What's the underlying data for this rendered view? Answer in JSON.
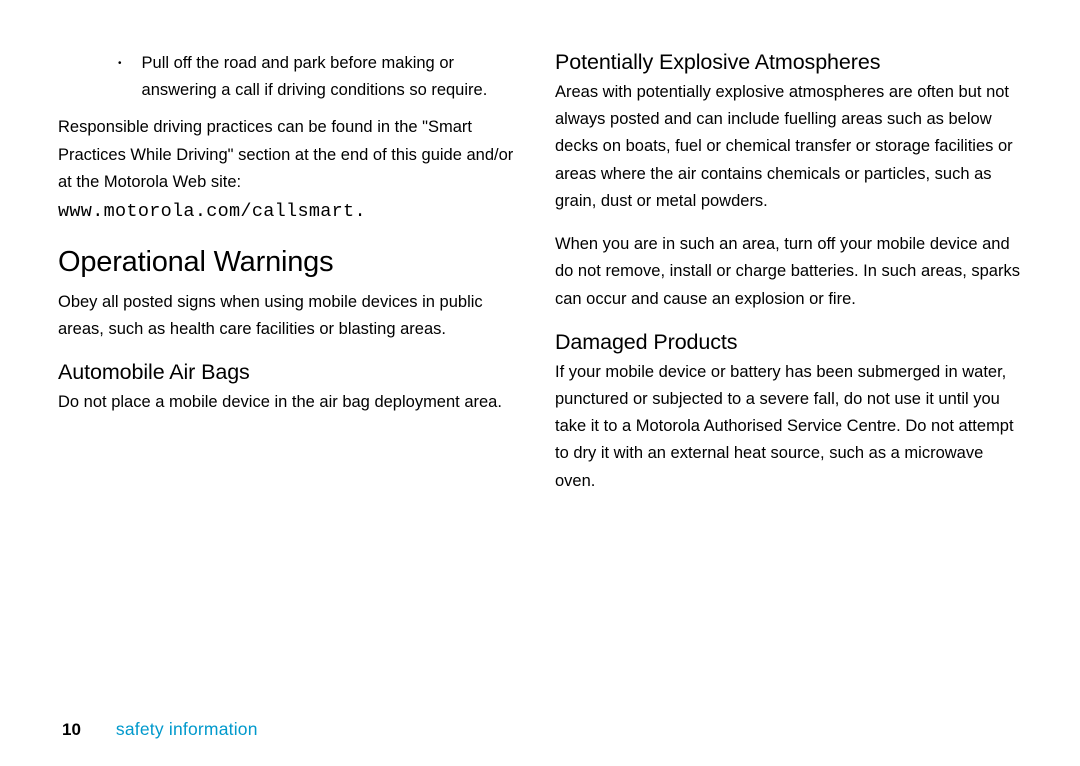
{
  "column1": {
    "bullet1": "Pull off the road and park before making or answering a call if driving conditions so require.",
    "para1": "Responsible driving practices can be found in the \"Smart Practices While Driving\" section at the end of this guide and/or at the Motorola Web site:",
    "url": "www.motorola.com/callsmart",
    "url_period": ".",
    "heading1": "Operational Warnings",
    "para2": "Obey all posted signs when using mobile devices in public areas, such as health care facilities or blasting areas.",
    "heading2": "Automobile Air Bags",
    "para3": "Do not place a mobile device in the air bag deployment area."
  },
  "column2": {
    "heading1": "Potentially Explosive Atmospheres",
    "para1": "Areas with potentially explosive atmospheres are often but not always posted and can include fuelling areas such as below decks on boats, fuel or chemical transfer or storage facilities or areas where the air contains chemicals or particles, such as grain, dust or metal powders.",
    "para2": "When you are in such an area, turn off your mobile device and do not remove, install or charge batteries. In such areas, sparks can occur and cause an explosion or fire.",
    "heading2": "Damaged Products",
    "para3": "If your mobile device or battery has been submerged in water, punctured or subjected to a severe fall, do not use it until you take it to a Motorola Authorised Service Centre. Do not attempt to dry it with an external heat source, such as a microwave oven."
  },
  "footer": {
    "page": "10",
    "section": "safety information"
  }
}
